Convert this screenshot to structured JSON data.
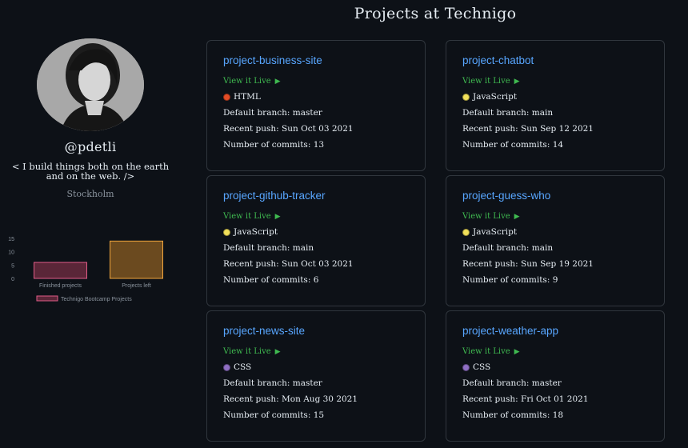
{
  "header": {
    "title": "Projects at Technigo"
  },
  "profile": {
    "username": "@pdetli",
    "bio": "< I build things both on the earth and on the web. />",
    "location": "Stockholm"
  },
  "chart_data": {
    "type": "bar",
    "categories": [
      "Finished projects",
      "Projects left"
    ],
    "series": [
      {
        "name": "Technigo Bootcamp Projects",
        "values": [
          6,
          14
        ]
      }
    ],
    "yticks": [
      0,
      5,
      10,
      15
    ],
    "ylim": [
      0,
      15
    ],
    "legend_position": "bottom",
    "colors": {
      "finished_fill": "#5a2638",
      "finished_stroke": "#e05c87",
      "left_fill": "#6b4a1f",
      "left_stroke": "#f0a53c"
    }
  },
  "labels": {
    "view_live": "View it Live",
    "branch_prefix": "Default branch: ",
    "push_prefix": "Recent push: ",
    "commits_prefix": "Number of commits: "
  },
  "projects": [
    {
      "name": "project-business-site",
      "language": "HTML",
      "lang_color": "#e34c26",
      "branch": "master",
      "push": "Sun Oct 03 2021",
      "commits": "13"
    },
    {
      "name": "project-chatbot",
      "language": "JavaScript",
      "lang_color": "#f1e05a",
      "branch": "main",
      "push": "Sun Sep 12 2021",
      "commits": "14"
    },
    {
      "name": "project-github-tracker",
      "language": "JavaScript",
      "lang_color": "#f1e05a",
      "branch": "main",
      "push": "Sun Oct 03 2021",
      "commits": "6"
    },
    {
      "name": "project-guess-who",
      "language": "JavaScript",
      "lang_color": "#f1e05a",
      "branch": "main",
      "push": "Sun Sep 19 2021",
      "commits": "9"
    },
    {
      "name": "project-news-site",
      "language": "CSS",
      "lang_color": "#8f6fc4",
      "branch": "master",
      "push": "Mon Aug 30 2021",
      "commits": "15"
    },
    {
      "name": "project-weather-app",
      "language": "CSS",
      "lang_color": "#8f6fc4",
      "branch": "master",
      "push": "Fri Oct 01 2021",
      "commits": "18"
    }
  ]
}
